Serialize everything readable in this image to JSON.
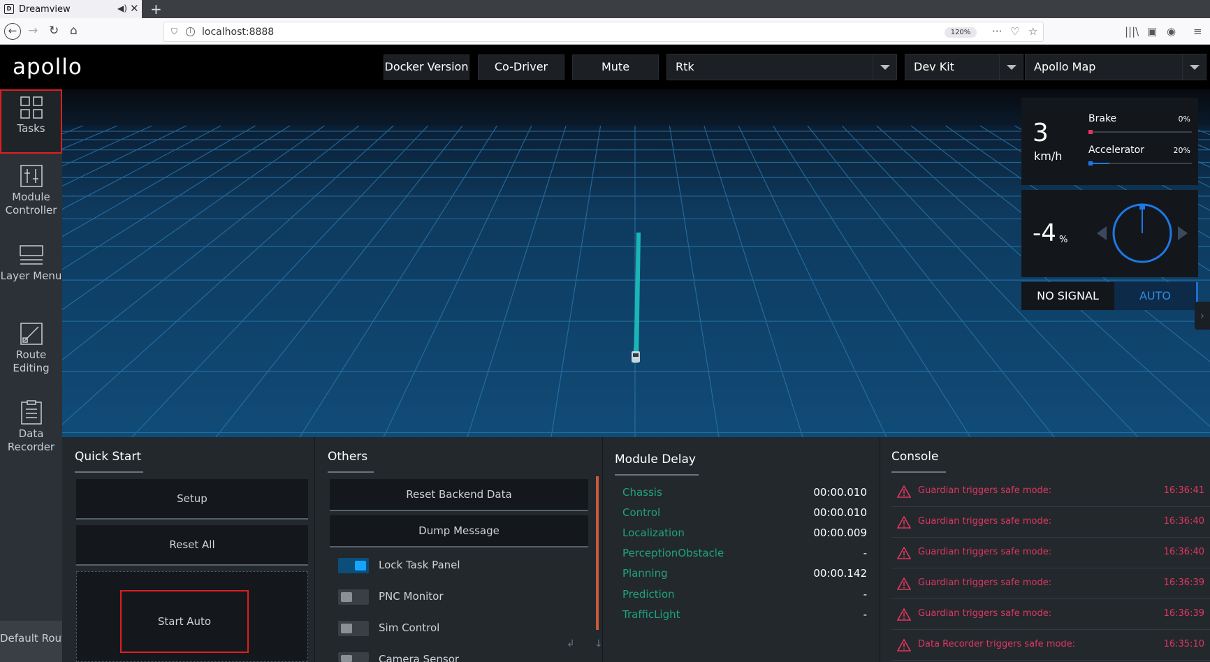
{
  "browser": {
    "tab_title": "Dreamview",
    "new_tab": "+",
    "url": "localhost:8888",
    "zoom": "120%"
  },
  "header": {
    "logo": "apollo",
    "buttons": [
      "Docker Version",
      "Co-Driver",
      "Mute"
    ],
    "selects": {
      "mode": "Rtk",
      "vehicle": "Dev Kit",
      "map": "Apollo Map"
    }
  },
  "sidebar": {
    "items": [
      {
        "label": "Tasks",
        "icon": "grid-icon"
      },
      {
        "label": "Module Controller",
        "icon": "sliders-icon"
      },
      {
        "label": "Layer Menu",
        "icon": "layers-icon"
      },
      {
        "label": "Route Editing",
        "icon": "route-icon"
      },
      {
        "label": "Data Recorder",
        "icon": "document-icon"
      }
    ],
    "default_routing": "Default Routing"
  },
  "dashboard": {
    "speed": "3",
    "speed_unit": "km/h",
    "brake_label": "Brake",
    "brake_value": "0%",
    "brake_fraction": 0.0,
    "accel_label": "Accelerator",
    "accel_value": "20%",
    "accel_fraction": 0.2,
    "steering": "-4",
    "steering_unit": "%",
    "signal": "NO SIGNAL",
    "drive_mode": "AUTO",
    "colors": {
      "brake": "#e0365f",
      "accel": "#1e78e6",
      "auto": "#2f8de0"
    }
  },
  "quick_start": {
    "title": "Quick Start",
    "buttons": [
      "Setup",
      "Reset All",
      "Start Auto"
    ]
  },
  "others": {
    "title": "Others",
    "buttons": [
      "Reset Backend Data",
      "Dump Message"
    ],
    "toggles": [
      {
        "label": "Lock Task Panel",
        "on": true
      },
      {
        "label": "PNC Monitor",
        "on": false
      },
      {
        "label": "Sim Control",
        "on": false
      },
      {
        "label": "Camera Sensor",
        "on": false
      }
    ]
  },
  "module_delay": {
    "title": "Module Delay",
    "rows": [
      {
        "name": "Chassis",
        "value": "00:00.010"
      },
      {
        "name": "Control",
        "value": "00:00.010"
      },
      {
        "name": "Localization",
        "value": "00:00.009"
      },
      {
        "name": "PerceptionObstacle",
        "value": "-"
      },
      {
        "name": "Planning",
        "value": "00:00.142"
      },
      {
        "name": "Prediction",
        "value": "-"
      },
      {
        "name": "TrafficLight",
        "value": "-"
      }
    ]
  },
  "console": {
    "title": "Console",
    "messages": [
      {
        "text": "Guardian triggers safe mode:",
        "time": "16:36:41"
      },
      {
        "text": "Guardian triggers safe mode:",
        "time": "16:36:40"
      },
      {
        "text": "Guardian triggers safe mode:",
        "time": "16:36:40"
      },
      {
        "text": "Guardian triggers safe mode:",
        "time": "16:36:39"
      },
      {
        "text": "Guardian triggers safe mode:",
        "time": "16:36:39"
      },
      {
        "text": "Data Recorder triggers safe mode:",
        "time": "16:35:10"
      }
    ]
  }
}
